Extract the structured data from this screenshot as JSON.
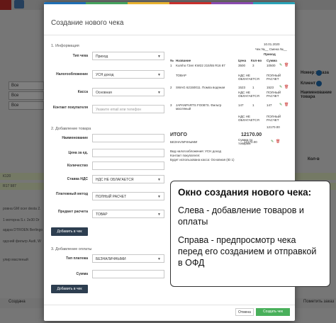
{
  "stripes": [
    "#1f6fb5",
    "#46a35e",
    "#e8b12f",
    "#c9302c",
    "#8a4bb0",
    "#2aa3b8"
  ],
  "background": {
    "filters": [
      "Все",
      "Все",
      "Все"
    ],
    "right_labels": [
      "Номер заказа",
      "Клиент",
      "Наименование товара"
    ],
    "col_header": "Кол-в",
    "rows": [
      "К120",
      "R17 987",
      "ровна GM осеr desta 2.",
      "1 моторна S.r. 2e30 Dr",
      "ардна DTROEN Berlingo",
      "одсний фильтр Audi, W",
      "улир масленый"
    ],
    "bottom_left": "Создана",
    "bottom_right": "Пометить заказ"
  },
  "modal": {
    "title": "Создание нового чека",
    "section1": "1. Информация",
    "fields1": [
      {
        "label": "Тип чека",
        "value": "Приход"
      },
      {
        "label": "Налогообложение",
        "value": "УСН доход"
      },
      {
        "label": "Касса",
        "value": "Основная"
      }
    ],
    "contact_label": "Контакт покупателя",
    "contact_placeholder": "Укажите email или телефон",
    "section2": "2. Добавление товара",
    "fields2": [
      {
        "label": "Наименование"
      },
      {
        "label": "Цена за ед."
      },
      {
        "label": "Количество"
      }
    ],
    "vat_label": "Ставка НДС",
    "vat_value": "НДС НЕ ОБЛАГАЕТСЯ",
    "payment_method_label": "Платежный метод",
    "payment_method_value": "ПОЛНЫЙ РАСЧЕТ",
    "subject_label": "Предмет расчета",
    "subject_value": "ТОВАР",
    "add_item_button": "Добавить в чек",
    "section3": "3. Добавление оплаты",
    "pay_type_label": "Тип платежа",
    "pay_type_value": "БЕЗНАЛИЧНЫМИ",
    "sum_label": "Сумма",
    "add_payment_button": "Добавить в чек",
    "cancel_button": "Отмена",
    "create_button": "Создать чек"
  },
  "receipt": {
    "date": "10.01.2020",
    "check_line": "Чек №__ Смена №__",
    "type": "Приход",
    "headers": [
      "№",
      "Название",
      "Цена",
      "Кол-во",
      "Сумма"
    ],
    "items": [
      {
        "num": "1",
        "name": "Kumho Г2ел KW22 215/55 R16 87",
        "price": "3500",
        "qty": "3",
        "sum": "10500",
        "vat": "НДС НЕ ОБЛАГАЕТСЯ",
        "method": "ПОЛНЫЙ РАСЧЕТ",
        "subject": "ТОВАР"
      },
      {
        "num": "2",
        "name": "SWAG 62150011. Помпа водяная",
        "price": "1523",
        "qty": "1",
        "sum": "1523",
        "vat": "НДС НЕ ОБЛАГАЕТСЯ",
        "method": "ПОЛНЫЙ РАСЧЕТ",
        "subject": ""
      },
      {
        "num": "3",
        "name": "JAPANPARTS FO087S. Фильтр масляный",
        "price": "147",
        "qty": "1",
        "sum": "147",
        "vat": "НДС НЕ ОБЛАГАЕТСЯ",
        "method": "ПОЛНЫЙ РАСЧЕТ",
        "subject": ""
      }
    ],
    "total_label": "ИТОГО",
    "total": "12170.00",
    "total_goods_label": "Сумма по товарам",
    "total_goods": "12170.00",
    "payment_label": "БЕЗНАЛИЧНЫМИ",
    "payment_sum": "12170.00",
    "tax_line": "Вид налогообложения: УСН доход",
    "contact_line": "Контакт покупателя:",
    "kassa_line": "Будет использована касса: Основная (ID 1)"
  },
  "callout": {
    "title": "Окно создания нового чека:",
    "line1": "Слева - добавление товаров и оплаты",
    "line2": "Справа - предпросмотр чека перед его созданием и отправкой в ОФД"
  }
}
